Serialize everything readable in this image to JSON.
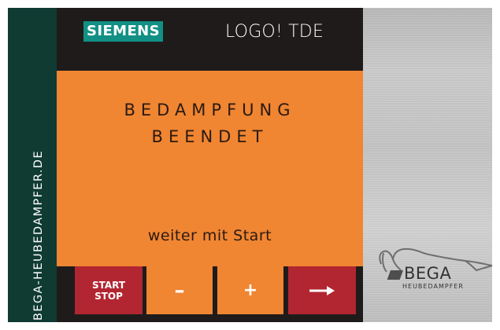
{
  "sidebar": {
    "website": "BEGA-HEUBEDAMPFER.DE"
  },
  "header": {
    "brand": "SIEMENS",
    "device": "LOGO! TDE"
  },
  "screen": {
    "line1": "BEDAMPFUNG",
    "line2": "BEENDET",
    "hint": "weiter mit Start"
  },
  "buttons": {
    "start_line1": "START",
    "start_line2": "STOP",
    "minus": "–",
    "plus": "+",
    "next_icon": "right-arrow-icon"
  },
  "logo": {
    "name": "BEGA",
    "sub": "HEUBEDAMPFER",
    "icon": "horse-logo-icon"
  },
  "colors": {
    "sidebar": "#0f3b33",
    "panel": "#1f1b1b",
    "display": "#f08532",
    "brand": "#129085",
    "accent_red": "#b22631",
    "metal": "#c4c4c4"
  }
}
